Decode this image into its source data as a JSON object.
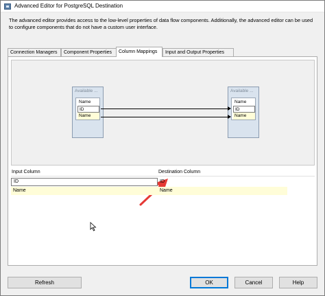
{
  "window": {
    "title": "Advanced Editor for PostgreSQL Destination"
  },
  "description": "The advanced editor provides access to the low-level properties of data flow components. Additionally, the advanced editor can be used to configure components that do not have a custom user interface.",
  "tabs": [
    {
      "label": "Connection Managers",
      "active": false
    },
    {
      "label": "Component Properties",
      "active": false
    },
    {
      "label": "Column Mappings",
      "active": true
    },
    {
      "label": "Input and Output Properties",
      "active": false
    }
  ],
  "mapping": {
    "source_box": {
      "title": "Available ...",
      "columns": [
        "Name",
        "ID",
        "Name"
      ]
    },
    "destination_box": {
      "title": "Available ...",
      "columns": [
        "Name",
        "ID",
        "Name"
      ]
    }
  },
  "grid": {
    "headers": [
      "Input Column",
      "Destination Column"
    ],
    "rows": [
      {
        "input": "ID",
        "destination": "ID"
      },
      {
        "input": "Name",
        "destination": "Name"
      }
    ]
  },
  "buttons": {
    "refresh": "Refresh",
    "ok": "OK",
    "cancel": "Cancel",
    "help": "Help"
  },
  "colors": {
    "annotation_arrow": "#e53935",
    "highlight_row": "#fffdd8",
    "default_button_border": "#0078d7"
  }
}
